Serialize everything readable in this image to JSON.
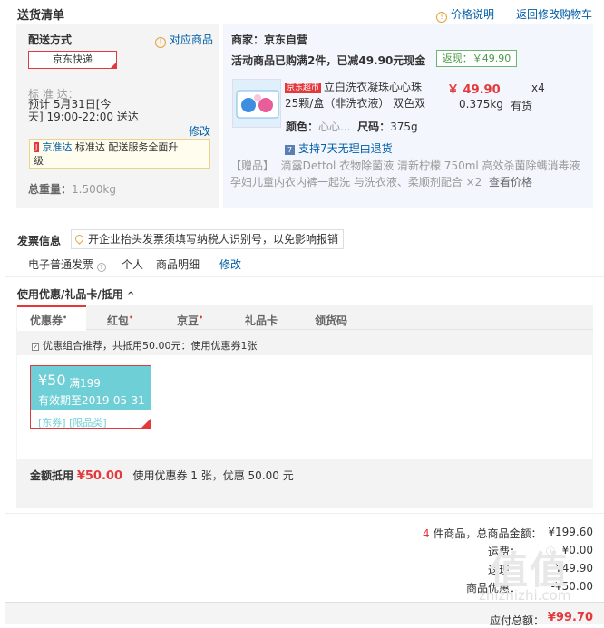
{
  "header": {
    "title": "送货清单",
    "price_note": "价格说明",
    "back_to_cart": "返回修改购物车"
  },
  "shipping": {
    "label": "配送方式",
    "match_goods": "对应商品",
    "method": "京东快递",
    "std_label": "标 准 达：",
    "std_time": "预计 5月31日[今天] 19:00-22:00 送达",
    "std_line1": "预计 5月31日[今",
    "std_line2": "天] 19:00-22:00 送达",
    "modify": "修改",
    "note_tag": "京准达",
    "note_text": "标准达  配送服务全面升级",
    "note_l1": "标准达  配送服务全面升",
    "note_l2": "级",
    "weight_label": "总重量：",
    "weight": "1.500kg"
  },
  "seller": {
    "label": "商家：",
    "name": "京东自营",
    "promo": "活动商品已购满2件，已减49.90元现金",
    "cashback": "返现：￥49.90"
  },
  "product": {
    "tag": "京东超市",
    "name_l1": "立白洗衣凝珠心心珠",
    "name_l2": "25颗/盒（非洗衣液） 双色双",
    "price": "￥ 49.90",
    "qty": "x4",
    "weight": "0.375kg",
    "stock": "有货",
    "color_label": "颜色：",
    "color": "心心...",
    "size_label": "尺码：",
    "size": "375g",
    "return_policy": "支持7天无理由退货",
    "gift_tag": "【赠品】",
    "gift_l1": "滴露Dettol 衣物除菌液 清新柠檬 750ml 高效杀菌除螨消毒液",
    "gift_l2": "孕妇儿童内衣内裤一起洗 与洗衣液、柔顺剂配合 ×2",
    "gift_link": "查看价格"
  },
  "invoice": {
    "title": "发票信息",
    "tip": "开企业抬头发票须填写纳税人识别号，以免影响报销",
    "type": "电子普通发票",
    "person": "个人",
    "detail": "商品明细",
    "modify": "修改"
  },
  "discount": {
    "title": "使用优惠/礼品卡/抵用",
    "tabs": [
      "优惠券",
      "红包",
      "京豆",
      "礼品卡",
      "领货码"
    ],
    "recommend": "优惠组合推荐，共抵用50.00元：使用优惠券1张",
    "coupon_amount": "¥50",
    "coupon_cond": "满199",
    "coupon_expire": "有效期至2019-05-31",
    "coupon_tags": "[东券]  [限品类]",
    "deduct_label": "金额抵用",
    "deduct_amount": "¥50.00",
    "deduct_desc": "使用优惠券 1 张，优惠 50.00 元"
  },
  "summary": {
    "count": "4",
    "count_text": " 件商品，总商品金额：",
    "total": "¥199.60",
    "freight_label": "运费：",
    "freight": "¥0.00",
    "discount_label": "返现：",
    "discount": "-¥49.90",
    "coupon_label": "商品优惠：",
    "coupon": "-¥50.00",
    "payable_label": "应付总额：",
    "payable": "¥99.70"
  },
  "watermark": {
    "main": "值值",
    "sub": "zhizhizhi.com"
  }
}
